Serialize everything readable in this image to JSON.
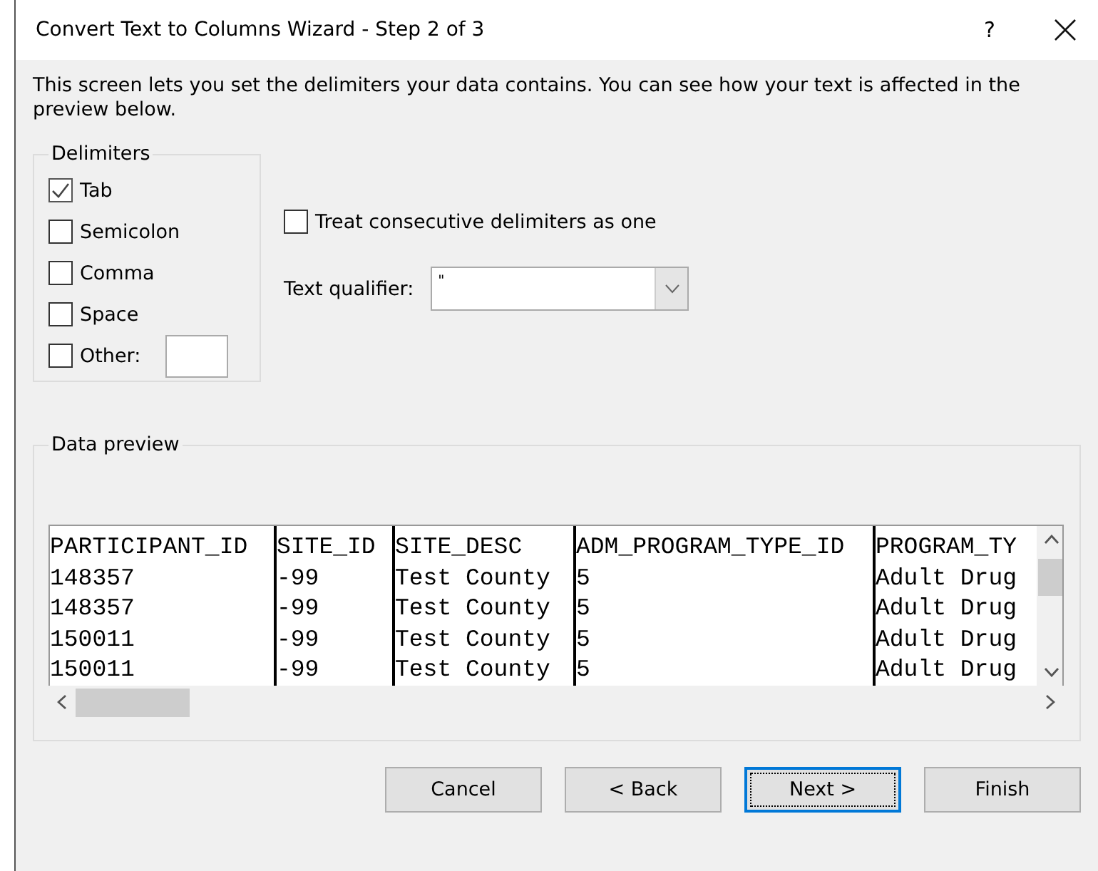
{
  "window": {
    "title": "Convert Text to Columns Wizard - Step 2 of 3",
    "help": "?"
  },
  "description": "This screen lets you set the delimiters your data contains.  You can see how your text is affected in the preview below.",
  "delimiters": {
    "title": "Delimiters",
    "items": [
      {
        "label": "Tab",
        "checked": true
      },
      {
        "label": "Semicolon",
        "checked": false
      },
      {
        "label": "Comma",
        "checked": false
      },
      {
        "label": "Space",
        "checked": false
      },
      {
        "label": "Other:",
        "checked": false,
        "kind": "other"
      }
    ]
  },
  "consecutive": {
    "label": "Treat consecutive delimiters as one",
    "checked": false
  },
  "text_qualifier": {
    "label": "Text qualifier:",
    "value": "\""
  },
  "preview": {
    "title": "Data preview",
    "columns": [
      {
        "header": "PARTICIPANT_ID",
        "cells": [
          "148357",
          "148357",
          "150011",
          "150011"
        ]
      },
      {
        "header": "SITE_ID",
        "cells": [
          "-99",
          "-99",
          "-99",
          "-99"
        ]
      },
      {
        "header": "SITE_DESC",
        "cells": [
          "Test County",
          "Test County",
          "Test County",
          "Test County"
        ]
      },
      {
        "header": "ADM_PROGRAM_TYPE_ID",
        "cells": [
          "5",
          "5",
          "5",
          "5"
        ]
      },
      {
        "header": "PROGRAM_TY",
        "cells": [
          "Adult Drug",
          "Adult Drug",
          "Adult Drug",
          "Adult Drug"
        ]
      }
    ]
  },
  "buttons": [
    {
      "label": "Cancel",
      "default": false
    },
    {
      "label": "< Back",
      "default": false
    },
    {
      "label": "Next >",
      "default": true
    },
    {
      "label": "Finish",
      "default": false
    }
  ]
}
